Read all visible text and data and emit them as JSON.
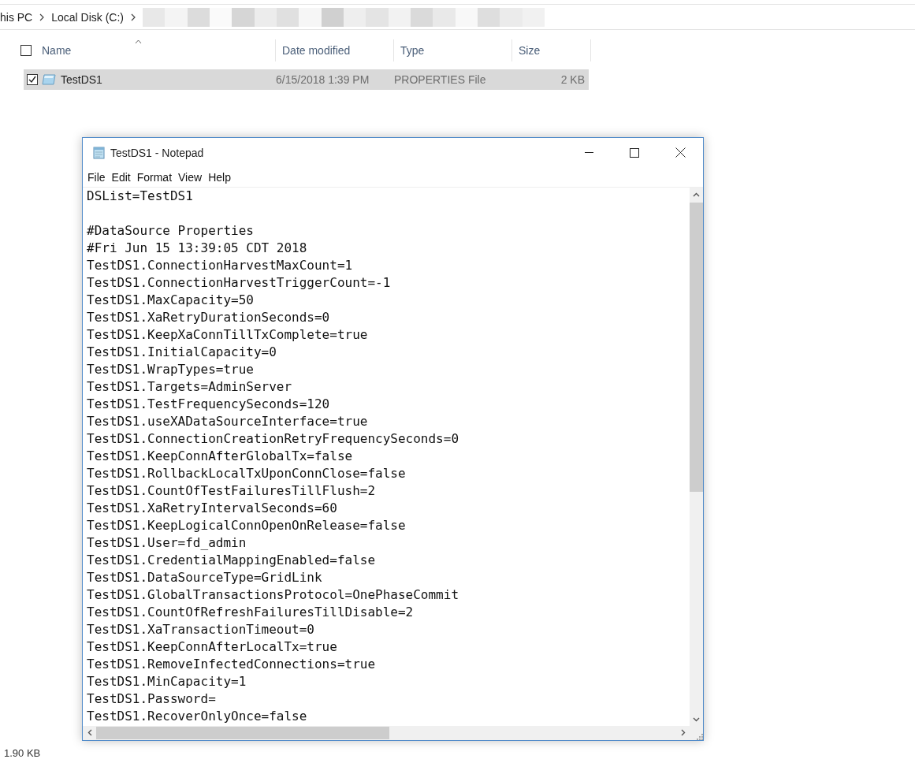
{
  "explorer": {
    "breadcrumb": [
      "his PC",
      "Local Disk (C:)"
    ],
    "select_all_checked": false,
    "columns": [
      {
        "label": "Name",
        "sorted": true
      },
      {
        "label": "Date modified",
        "sorted": false
      },
      {
        "label": "Type",
        "sorted": false
      },
      {
        "label": "Size",
        "sorted": false
      }
    ],
    "files": [
      {
        "name": "TestDS1",
        "date_modified": "6/15/2018 1:39 PM",
        "type": "PROPERTIES File",
        "size": "2 KB",
        "selected": true,
        "checked": true
      }
    ],
    "status_bar": {
      "selection_size": "1.90 KB"
    }
  },
  "notepad": {
    "title": "TestDS1 - Notepad",
    "menu": [
      "File",
      "Edit",
      "Format",
      "View",
      "Help"
    ],
    "paragraphs": [
      [
        "DSList=TestDS1"
      ],
      [
        "#DataSource Properties",
        "#Fri Jun 15 13:39:05 CDT 2018",
        "TestDS1.ConnectionHarvestMaxCount=1",
        "TestDS1.ConnectionHarvestTriggerCount=-1",
        "TestDS1.MaxCapacity=50",
        "TestDS1.XaRetryDurationSeconds=0",
        "TestDS1.KeepXaConnTillTxComplete=true",
        "TestDS1.InitialCapacity=0",
        "TestDS1.WrapTypes=true",
        "TestDS1.Targets=AdminServer",
        "TestDS1.TestFrequencySeconds=120",
        "TestDS1.useXADataSourceInterface=true",
        "TestDS1.ConnectionCreationRetryFrequencySeconds=0",
        "TestDS1.KeepConnAfterGlobalTx=false",
        "TestDS1.RollbackLocalTxUponConnClose=false",
        "TestDS1.CountOfTestFailuresTillFlush=2",
        "TestDS1.XaRetryIntervalSeconds=60",
        "TestDS1.KeepLogicalConnOpenOnRelease=false",
        "TestDS1.User=fd_admin",
        "TestDS1.CredentialMappingEnabled=false",
        "TestDS1.DataSourceType=GridLink",
        "TestDS1.GlobalTransactionsProtocol=OnePhaseCommit",
        "TestDS1.CountOfRefreshFailuresTillDisable=2",
        "TestDS1.XaTransactionTimeout=0",
        "TestDS1.KeepConnAfterLocalTx=true",
        "TestDS1.RemoveInfectedConnections=true",
        "TestDS1.MinCapacity=1",
        "TestDS1.Password=",
        "TestDS1.RecoverOnlyOnce=false"
      ]
    ]
  }
}
